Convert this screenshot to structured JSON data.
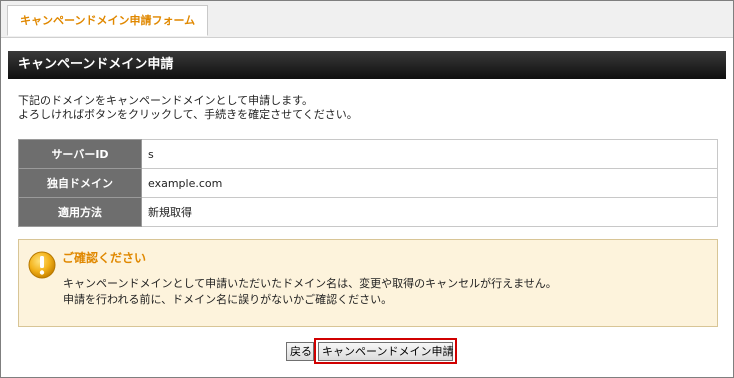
{
  "tab": {
    "label": "キャンペーンドメイン申請フォーム"
  },
  "section": {
    "title": "キャンペーンドメイン申請"
  },
  "description": {
    "line1": "下記のドメインをキャンペーンドメインとして申請します。",
    "line2": "よろしければボタンをクリックして、手続きを確定させてください。"
  },
  "table": {
    "rows": [
      {
        "label": "サーバーID",
        "value": "s"
      },
      {
        "label": "独自ドメイン",
        "value": "example.com"
      },
      {
        "label": "適用方法",
        "value": "新規取得"
      }
    ]
  },
  "notice": {
    "icon": "exclamation-icon",
    "title": "ご確認ください",
    "line1": "キャンペーンドメインとして申請いただいたドメイン名は、変更や取得のキャンセルが行えません。",
    "line2": "申請を行われる前に、ドメイン名に誤りがないかご確認ください。"
  },
  "buttons": {
    "back_label": "戻る",
    "submit_label": "キャンペーンドメイン申請"
  },
  "colors": {
    "accent": "#e08800",
    "highlight_border": "#d00000",
    "header_bg": "#1a1a1a",
    "notice_bg": "#fdf3dc"
  }
}
